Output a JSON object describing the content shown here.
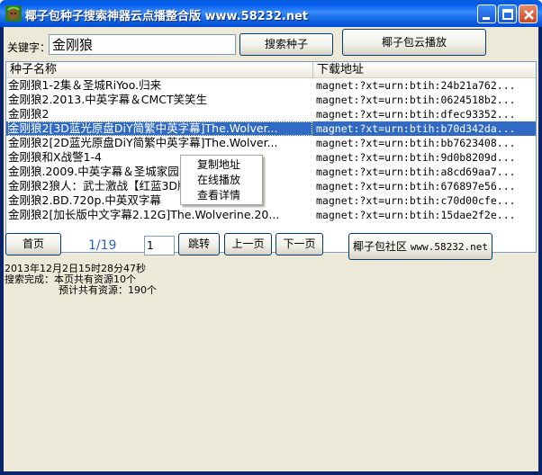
{
  "window": {
    "title": "椰子包种子搜索神器云点播整合版 www.58232.net",
    "colors": {
      "titlebar": "#0058ee",
      "selection": "#316ac5",
      "page_indicator": "#3060c8"
    }
  },
  "search": {
    "label": "关键字：",
    "value": "金刚狼",
    "search_button": "搜索种子",
    "cloud_button": "椰子包云播放"
  },
  "list": {
    "columns": [
      "种子名称",
      "下载地址"
    ],
    "rows": [
      {
        "name": "金刚狼1-2集＆圣城RiYoo.归来",
        "magnet": "magnet:?xt=urn:btih:24b21a762..."
      },
      {
        "name": "金刚狼2.2013.中英字幕＆CMCT笑笑生",
        "magnet": "magnet:?xt=urn:btih:0624518b2..."
      },
      {
        "name": "金刚狼2",
        "magnet": "magnet:?xt=urn:btih:dfec93352..."
      },
      {
        "name": "金刚狼2[3D蓝光原盘DiY简繁中英字幕]The.Wolver...",
        "magnet": "magnet:?xt=urn:btih:b70d342da..."
      },
      {
        "name": "金刚狼2[2D蓝光原盘DiY简繁中英字幕]The.Wolver...",
        "magnet": "magnet:?xt=urn:btih:bb7623408..."
      },
      {
        "name": "金刚狼和X战警1-4",
        "magnet": "magnet:?xt=urn:btih:9d0b8209d..."
      },
      {
        "name": "金刚狼.2009.中英字幕＆圣城家园",
        "magnet": "magnet:?xt=urn:btih:a8cd69aa7..."
      },
      {
        "name": "金刚狼2狼人：武士激战【红蓝3D版】",
        "magnet": "magnet:?xt=urn:btih:676897e56..."
      },
      {
        "name": "金刚狼2.BD.720p.中英双字幕",
        "magnet": "magnet:?xt=urn:btih:c70d00cfe..."
      },
      {
        "name": "金刚狼2[加长版中文字幕2.12G]The.Wolverine.20...",
        "magnet": "magnet:?xt=urn:btih:15dae2f2e..."
      }
    ],
    "selected_index": 3
  },
  "context_menu": {
    "items": [
      "复制地址",
      "在线播放",
      "查看详情"
    ]
  },
  "pager": {
    "first_button": "首页",
    "page_indicator": "1/19",
    "page_input": "1",
    "jump_button": "跳转",
    "prev_button": "上一页",
    "next_button": "下一页",
    "community_button": "椰子包社区",
    "community_url": "www.58232.net"
  },
  "log": {
    "timestamp": "2013年12月2日15时28分47秒",
    "line_found": "搜索完成：本页共有资源10个",
    "line_total": "预计共有资源：190个"
  }
}
